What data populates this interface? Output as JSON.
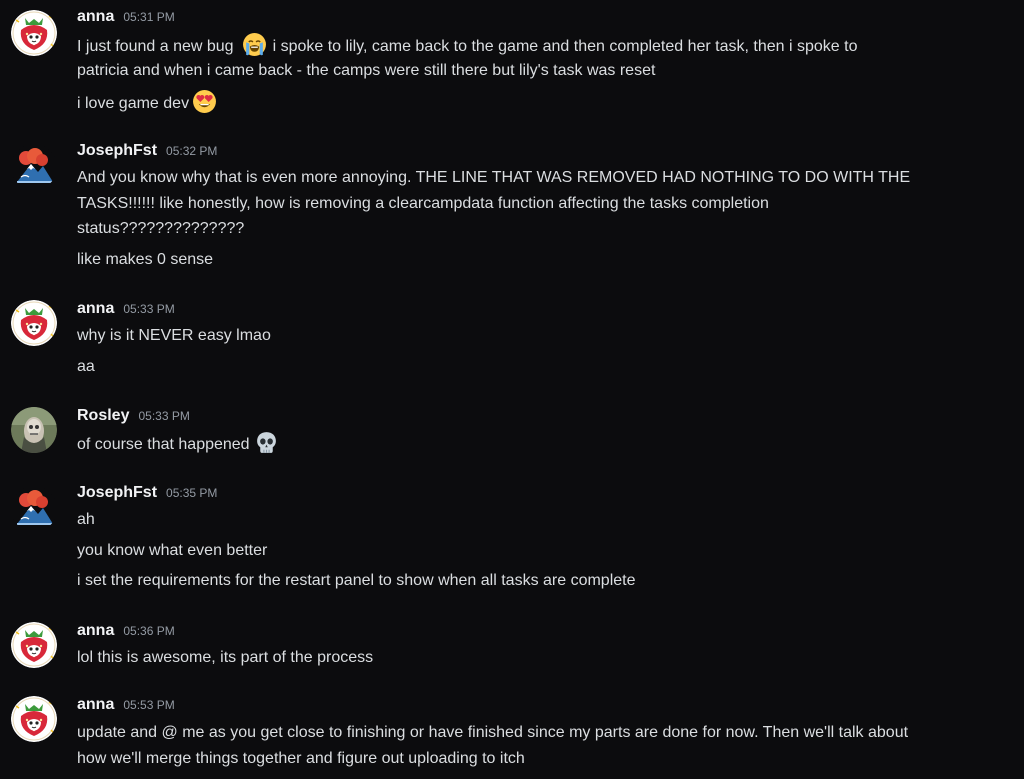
{
  "messages": [
    {
      "author": "anna",
      "time": "05:31 PM",
      "lines": [
        {
          "segments": [
            "I just found a new bug",
            "i spoke to lily, came back to the game and then completed her task, then i spoke to"
          ]
        },
        {
          "segments": [
            "patricia and when i came back - the camps were still there but lily's task was reset"
          ]
        },
        {
          "segments": [
            "i love game dev"
          ]
        }
      ]
    },
    {
      "author": "JosephFst",
      "time": "05:32 PM",
      "lines": [
        {
          "segments": [
            "And you know why that is even more annoying. THE LINE THAT WAS REMOVED HAD NOTHING TO DO WITH THE"
          ]
        },
        {
          "segments": [
            "TASKS!!!!!! like honestly, how is removing a clearcampdata function affecting the tasks completion"
          ]
        },
        {
          "segments": [
            "status??????????????"
          ]
        },
        {
          "segments": [
            "like makes 0 sense"
          ]
        }
      ]
    },
    {
      "author": "anna",
      "time": "05:33 PM",
      "lines": [
        {
          "segments": [
            "why is it NEVER easy lmao"
          ]
        },
        {
          "segments": [
            "aa"
          ]
        }
      ]
    },
    {
      "author": "Rosley",
      "time": "05:33 PM",
      "lines": [
        {
          "segments": [
            "of course that happened"
          ]
        }
      ]
    },
    {
      "author": "JosephFst",
      "time": "05:35 PM",
      "lines": [
        {
          "segments": [
            "ah"
          ]
        },
        {
          "segments": [
            "you know what even better"
          ]
        },
        {
          "segments": [
            "i set the requirements for the restart panel to show when all tasks are complete"
          ]
        }
      ]
    },
    {
      "author": "anna",
      "time": "05:36 PM",
      "lines": [
        {
          "segments": [
            "lol this is awesome, its part of the process"
          ]
        }
      ]
    },
    {
      "author": "anna",
      "time": "05:53 PM",
      "lines": [
        {
          "segments": [
            "update and @ me as you get close to finishing or have finished since my parts are done for now. Then we'll talk about"
          ]
        },
        {
          "segments": [
            "how we'll merge things together and figure out uploading to itch"
          ]
        }
      ]
    }
  ],
  "emojis": [
    "crying-face",
    "heart-eyes-face",
    "skull"
  ],
  "colors": {
    "background": "#0c0c0e",
    "author": "#f2f3f5",
    "timestamp": "#949ba4",
    "text": "#dbdee1"
  }
}
